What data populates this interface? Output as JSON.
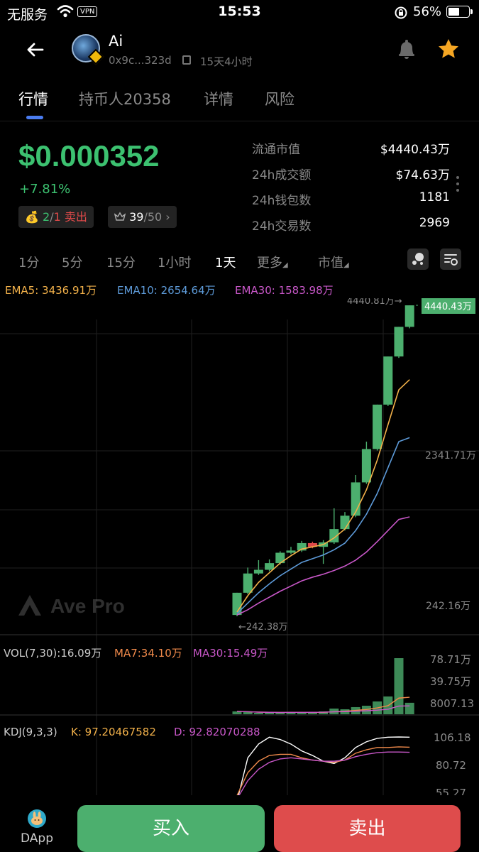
{
  "status_bar": {
    "carrier": "无服务",
    "vpn": "VPN",
    "time": "15:53",
    "battery": "56%",
    "battery_level": 0.56
  },
  "header": {
    "token_name": "Ai",
    "address": "0x9c...323d",
    "age": "15天4小时",
    "icons": [
      "back-arrow-icon",
      "bell-icon",
      "star-icon",
      "copy-icon"
    ]
  },
  "tabs": [
    "行情",
    "持币人20358",
    "详情",
    "风险"
  ],
  "summary": {
    "price": "$0.000352",
    "change": "+7.81%",
    "trades_pill": {
      "buy": "2",
      "sep": "/",
      "sell": "1",
      "label": "卖出"
    },
    "rank_pill": {
      "value": "39",
      "total": "/50"
    },
    "stats": [
      {
        "label": "流通市值",
        "value": "$4440.43万"
      },
      {
        "label": "24h成交额",
        "value": "$74.63万"
      },
      {
        "label": "24h钱包数",
        "value": "1181"
      },
      {
        "label": "24h交易数",
        "value": "2969"
      }
    ]
  },
  "timeframes": {
    "items": [
      "1分",
      "5分",
      "15分",
      "1小时",
      "1天"
    ],
    "active": "1天",
    "more": "更多",
    "metric": "市值"
  },
  "indicators": {
    "ema5": "EMA5: 3436.91万",
    "ema10": "EMA10: 2654.64万",
    "ema30": "EMA30: 1583.98万"
  },
  "chart": {
    "high_label": "4440.81万→",
    "current_label": "4440.43万",
    "mid_label": "2341.71万",
    "low_axis_label": "242.16万",
    "low_label": "←242.38万",
    "watermark": "Ave Pro",
    "vol": {
      "label": "VOL(7,30):16.09万",
      "ma7": "MA7:34.10万",
      "ma30": "MA30:15.49万",
      "axis": [
        "78.71万",
        "39.75万",
        "8007.13"
      ]
    },
    "kdj": {
      "label": "KDJ(9,3,3)",
      "k": "K:  97.20467582",
      "d": "D:  92.82070288",
      "axis": [
        "106.18",
        "80.72",
        "55.27"
      ]
    },
    "colors": {
      "up": "#4caf6e",
      "down": "#e04a4a",
      "ema5": "#f2b14a",
      "ema10": "#5d9ad8",
      "ema30": "#c857c8",
      "ma7": "#f08a4b",
      "ma30": "#c857c8",
      "k": "#ffffff",
      "d": "#f08a4b",
      "j": "#c857c8"
    }
  },
  "chart_data": {
    "type": "candlestick",
    "unit": "万",
    "ylim": [
      242.16,
      4440.81
    ],
    "candles": [
      {
        "open": 260,
        "close": 560,
        "high": 560,
        "low": 242.38
      },
      {
        "open": 560,
        "close": 820,
        "high": 900,
        "low": 540
      },
      {
        "open": 820,
        "close": 870,
        "high": 1000,
        "low": 800
      },
      {
        "open": 870,
        "close": 960,
        "high": 1010,
        "low": 850
      },
      {
        "open": 960,
        "close": 1100,
        "high": 1120,
        "low": 940
      },
      {
        "open": 1100,
        "close": 1130,
        "high": 1180,
        "low": 1080
      },
      {
        "open": 1130,
        "close": 1230,
        "high": 1260,
        "low": 1110
      },
      {
        "open": 1230,
        "close": 1180,
        "high": 1250,
        "low": 1160
      },
      {
        "open": 1180,
        "close": 1240,
        "high": 1270,
        "low": 950
      },
      {
        "open": 1240,
        "close": 1420,
        "high": 1700,
        "low": 1220
      },
      {
        "open": 1420,
        "close": 1600,
        "high": 1650,
        "low": 1400
      },
      {
        "open": 1600,
        "close": 2050,
        "high": 2150,
        "low": 1580
      },
      {
        "open": 2050,
        "close": 2500,
        "high": 2600,
        "low": 2030
      },
      {
        "open": 2500,
        "close": 3100,
        "high": 3100,
        "low": 2480
      },
      {
        "open": 3100,
        "close": 3750,
        "high": 3750,
        "low": 3080
      },
      {
        "open": 3750,
        "close": 4150,
        "high": 4150,
        "low": 3730
      },
      {
        "open": 4150,
        "close": 4440.43,
        "high": 4440.81,
        "low": 4130
      }
    ],
    "ema5": [
      300,
      520,
      700,
      830,
      960,
      1060,
      1150,
      1180,
      1210,
      1300,
      1420,
      1650,
      1950,
      2350,
      2830,
      3300,
      3436.91
    ],
    "ema10": [
      280,
      420,
      560,
      680,
      790,
      880,
      970,
      1020,
      1070,
      1140,
      1230,
      1400,
      1620,
      1900,
      2250,
      2600,
      2654.64
    ],
    "ema30": [
      260,
      330,
      420,
      500,
      580,
      650,
      720,
      770,
      810,
      860,
      920,
      1000,
      1110,
      1250,
      1400,
      1550,
      1583.98
    ],
    "volume": [
      4,
      3,
      2,
      2,
      2,
      3,
      3,
      3,
      4,
      8,
      7,
      10,
      12,
      18,
      25,
      78.71,
      16.09
    ]
  }
}
